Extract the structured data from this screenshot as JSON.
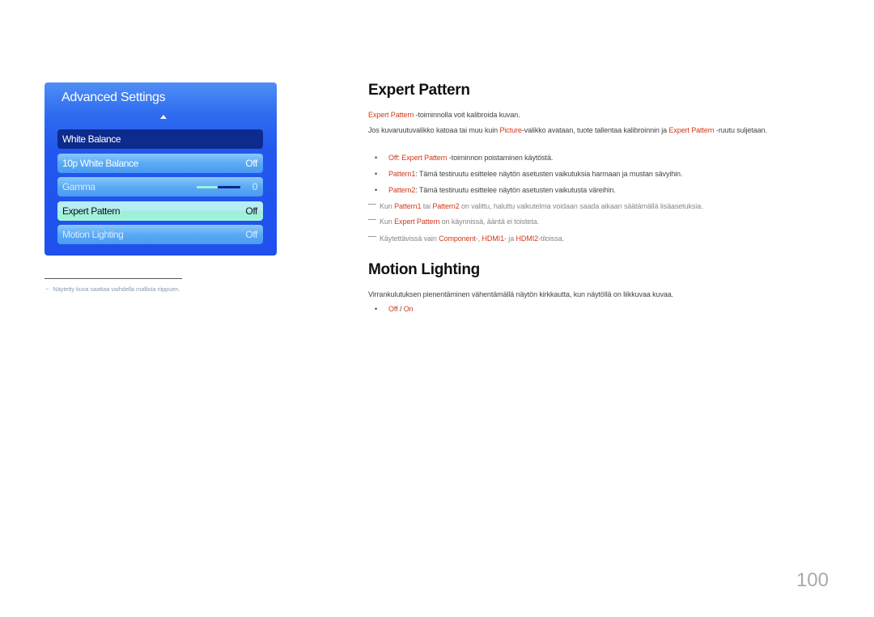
{
  "osd": {
    "title": "Advanced Settings",
    "items": [
      {
        "label": "White Balance",
        "value": ""
      },
      {
        "label": "10p White Balance",
        "value": "Off"
      },
      {
        "label": "Gamma",
        "value": "0",
        "slider_fraction": 0.48
      },
      {
        "label": "Expert Pattern",
        "value": "Off"
      },
      {
        "label": "Motion Lighting",
        "value": "Off"
      }
    ]
  },
  "footnote": {
    "dash": "−",
    "text": "Näytetty kuva saattaa vaihdella mallista riippuen."
  },
  "expert_pattern": {
    "title": "Expert Pattern",
    "intro": {
      "hl": "Expert Pattern",
      "rest": " -toiminnolla voit kalibroida kuvan."
    },
    "para2": {
      "a": "Jos kuvaruutuvalikko katoaa tai muu kuin ",
      "hl1": "Picture",
      "b": "-valikko avataan, tuote tallentaa kalibroinnin ja ",
      "hl2": "Expert Pattern",
      "c": " -ruutu suljetaan."
    },
    "bullets": [
      {
        "hl": "Off",
        "sep": ": ",
        "hl2": "Expert Pattern",
        "rest": " -toiminnon poistaminen käytöstä."
      },
      {
        "hl": "Pattern1",
        "rest": ": Tämä testiruutu esittelee näytön asetusten vaikutuksia harmaan ja mustan sävyihin."
      },
      {
        "hl": "Pattern2",
        "rest": ": Tämä testiruutu esittelee näytön asetusten vaikutusta väreihin."
      }
    ],
    "notes": [
      {
        "a": "Kun ",
        "hl1": "Pattern1",
        "b": " tai ",
        "hl2": "Pattern2",
        "c": " on valittu, haluttu vaikutelma voidaan saada aikaan säätämällä lisäasetuksia."
      },
      {
        "a": "Kun ",
        "hl1": "Expert Pattern",
        "b": " on käynnissä, ääntä ei toisteta."
      },
      {
        "a": "Käytettävissä vain ",
        "hl1": "Component",
        "b": "-, ",
        "hl2": "HDMI1",
        "c": "- ja ",
        "hl3": "HDMI2",
        "d": "-tiloissa."
      }
    ]
  },
  "motion_lighting": {
    "title": "Motion Lighting",
    "desc": "Virrankulutuksen pienentäminen vähentämällä näytön kirkkautta, kun näytöllä on liikkuvaa kuvaa.",
    "options": {
      "off": "Off",
      "sep": " / ",
      "on": "On"
    }
  },
  "page_number": "100",
  "colors": {
    "accent": "#d2381a",
    "osd_blue": "#1f50ee",
    "osd_selected": "#0c2b8c",
    "osd_highlight": "#9ef0d8"
  }
}
